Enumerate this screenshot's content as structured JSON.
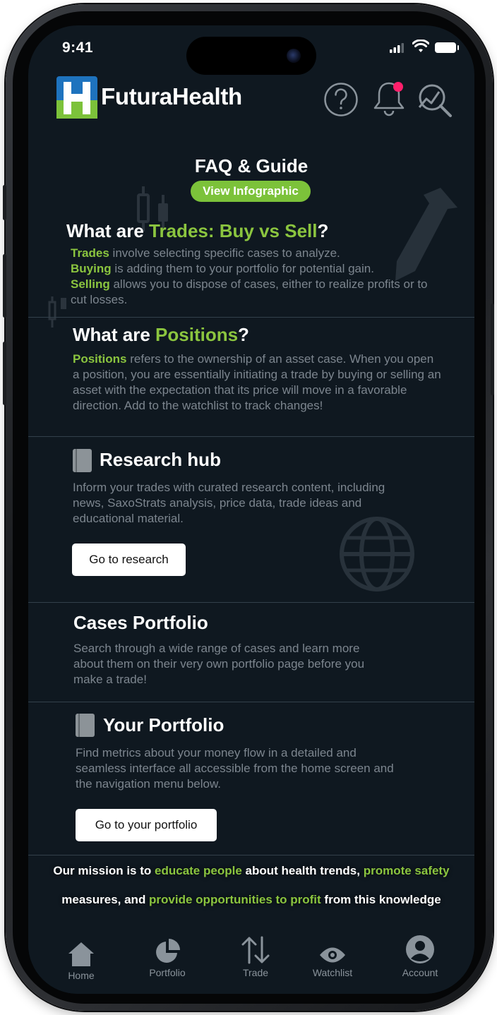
{
  "status": {
    "time": "9:41"
  },
  "header": {
    "brand": "FuturaHealth",
    "icons": [
      "help-icon",
      "notification-bell-icon",
      "search-analytics-icon"
    ]
  },
  "faq": {
    "title": "FAQ & Guide",
    "infographic_label": "View Infographic"
  },
  "trades": {
    "title_prefix": "What are ",
    "title_highlight": "Trades: Buy vs Sell",
    "title_suffix": "?",
    "term1": "Trades",
    "text1": " involve selecting specific cases to analyze.",
    "term2": "Buying",
    "text2": " is adding them to your portfolio for potential gain.",
    "term3": "Selling",
    "text3": " allows you to dispose of cases, either to realize profits or to cut losses."
  },
  "positions": {
    "title_prefix": "What are ",
    "title_highlight": "Positions",
    "title_suffix": "?",
    "term": "Positions",
    "text": " refers to the ownership of an asset case. When you open a position, you are essentially initiating a trade by buying or selling an asset with the expectation that its price will move in a favorable direction. Add to the watchlist to track changes!"
  },
  "research": {
    "title": "Research hub",
    "text": "Inform your trades with curated research content, including news, SaxoStrats analysis, price data, trade ideas and educational material.",
    "button": "Go to research"
  },
  "cases": {
    "title": "Cases Portfolio",
    "text": "Search through a wide range of cases and learn more about them on their very own portfolio page before you make a trade!"
  },
  "your_portfolio": {
    "title": "Your Portfolio",
    "text": "Find metrics about your money flow in a detailed and seamless interface all accessible from the home screen and the navigation menu below.",
    "button": "Go to your portfolio"
  },
  "mission": {
    "p1": "Our mission is to ",
    "g1": "educate people",
    "p2": " about health trends, ",
    "g2": "promote safety",
    "p3": "measures, and ",
    "g3": "provide opportunities to profit",
    "p4": " from this knowledge"
  },
  "tabs": [
    {
      "label": "Home",
      "icon": "home-icon"
    },
    {
      "label": "Portfolio",
      "icon": "pie-chart-icon"
    },
    {
      "label": "Trade",
      "icon": "up-down-arrows-icon"
    },
    {
      "label": "Watchlist",
      "icon": "eye-icon"
    },
    {
      "label": "Account",
      "icon": "account-icon"
    }
  ],
  "colors": {
    "accent": "#8bc53f",
    "background": "#0f1820",
    "notification_dot": "#ff1f6b",
    "logo_blue": "#1e73be"
  }
}
